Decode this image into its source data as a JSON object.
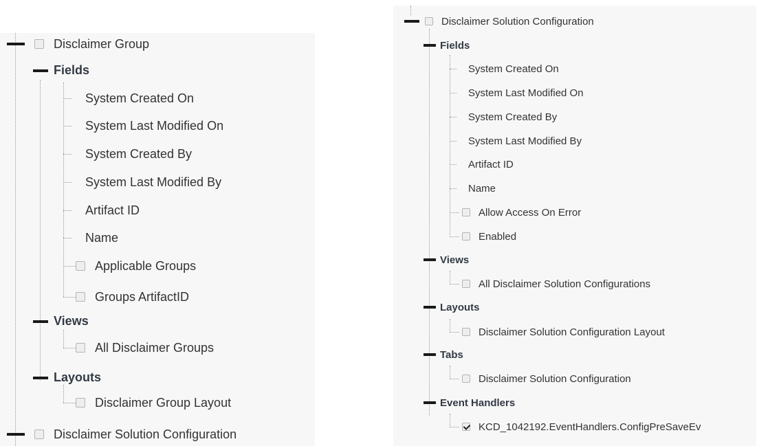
{
  "left_tree": {
    "root": "Disclaimer Group",
    "sections": {
      "fields": {
        "label": "Fields",
        "items": [
          {
            "label": "System Created On"
          },
          {
            "label": "System Last Modified On"
          },
          {
            "label": "System Created By"
          },
          {
            "label": "System Last Modified By"
          },
          {
            "label": "Artifact ID"
          },
          {
            "label": "Name"
          },
          {
            "label": "Applicable Groups",
            "checked": false
          },
          {
            "label": "Groups ArtifactID",
            "checked": false
          }
        ]
      },
      "views": {
        "label": "Views",
        "items": [
          {
            "label": "All Disclaimer Groups",
            "checked": false
          }
        ]
      },
      "layouts": {
        "label": "Layouts",
        "items": [
          {
            "label": "Disclaimer Group Layout",
            "checked": false
          }
        ]
      }
    },
    "next_root": "Disclaimer Solution Configuration"
  },
  "right_tree": {
    "root": "Disclaimer Solution Configuration",
    "sections": {
      "fields": {
        "label": "Fields",
        "items": [
          {
            "label": "System Created On"
          },
          {
            "label": "System Last Modified On"
          },
          {
            "label": "System Created By"
          },
          {
            "label": "System Last Modified By"
          },
          {
            "label": "Artifact ID"
          },
          {
            "label": "Name"
          },
          {
            "label": "Allow Access On Error",
            "checked": false
          },
          {
            "label": "Enabled",
            "checked": false
          }
        ]
      },
      "views": {
        "label": "Views",
        "items": [
          {
            "label": "All Disclaimer Solution Configurations",
            "checked": false
          }
        ]
      },
      "layouts": {
        "label": "Layouts",
        "items": [
          {
            "label": "Disclaimer Solution Configuration Layout",
            "checked": false
          }
        ]
      },
      "tabs": {
        "label": "Tabs",
        "items": [
          {
            "label": "Disclaimer Solution Configuration",
            "checked": false
          }
        ]
      },
      "event_handlers": {
        "label": "Event Handlers",
        "items": [
          {
            "label": "KCD_1042192.EventHandlers.ConfigPreSaveEv",
            "checked": true
          }
        ]
      }
    }
  }
}
